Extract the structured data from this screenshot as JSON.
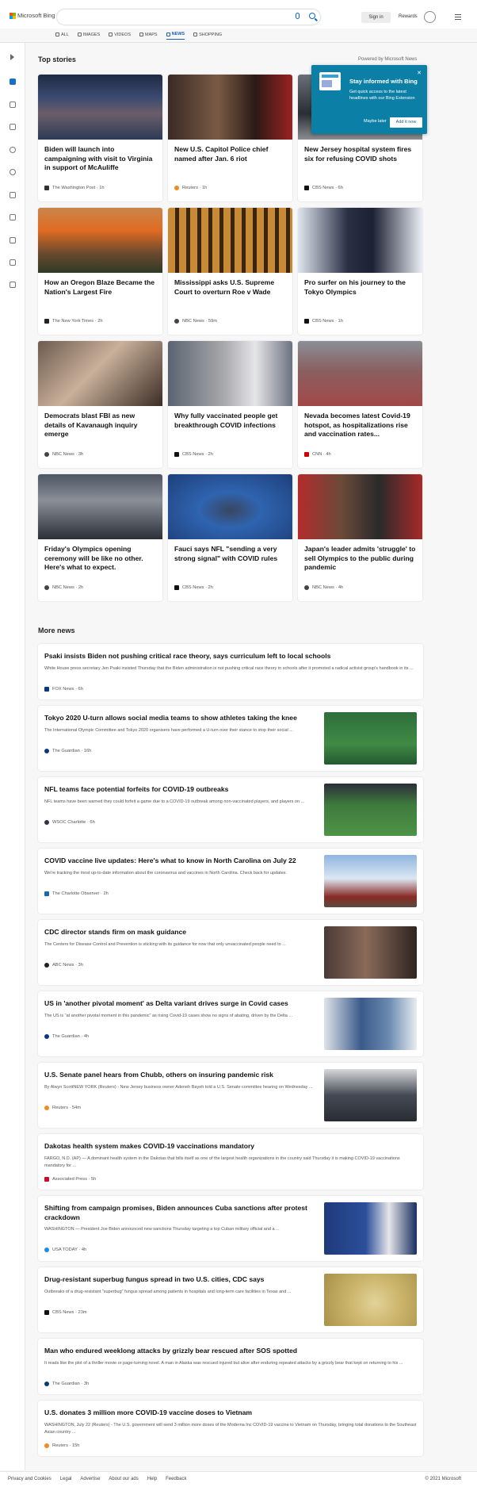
{
  "header": {
    "logo_text": "Microsoft Bing",
    "sign_in": "Sign in",
    "rewards": "Rewards"
  },
  "nav": [
    {
      "label": "ALL",
      "icon": "search-icon"
    },
    {
      "label": "IMAGES",
      "icon": "image-icon"
    },
    {
      "label": "VIDEOS",
      "icon": "video-icon"
    },
    {
      "label": "MAPS",
      "icon": "map-pin-icon"
    },
    {
      "label": "NEWS",
      "icon": "news-icon",
      "active": true
    },
    {
      "label": "SHOPPING",
      "icon": "shopping-bag-icon"
    }
  ],
  "top_stories": {
    "title": "Top stories",
    "powered_by": "Powered by Microsoft News",
    "cards": [
      {
        "title": "Biden will launch into campaigning with visit to Virginia in support of McAuliffe",
        "source": "The Washington Post · 1h"
      },
      {
        "title": "New U.S. Capitol Police chief named after Jan. 6 riot",
        "source": "Reuters · 1h"
      },
      {
        "title": "New Jersey hospital system fires six for refusing COVID shots",
        "source": "CBS News · 6h"
      },
      {
        "title": "How an Oregon Blaze Became the Nation's Largest Fire",
        "source": "The New York Times · 2h"
      },
      {
        "title": "Mississippi asks U.S. Supreme Court to overturn Roe v Wade",
        "source": "NBC News · 59m"
      },
      {
        "title": "Pro surfer on his journey to the Tokyo Olympics",
        "source": "CBS News · 1h"
      },
      {
        "title": "Democrats blast FBI as new details of Kavanaugh inquiry emerge",
        "source": "NBC News · 3h"
      },
      {
        "title": "Why fully vaccinated people get breakthrough COVID infections",
        "source": "CBS News · 2h"
      },
      {
        "title": "Nevada becomes latest Covid-19 hotspot, as hospitalizations rise and vaccination rates...",
        "source": "CNN · 4h"
      },
      {
        "title": "Friday's Olympics opening ceremony will be like no other. Here's what to expect.",
        "source": "NBC News · 2h"
      },
      {
        "title": "Fauci says NFL \"sending a very strong signal\" with COVID rules",
        "source": "CBS News · 2h"
      },
      {
        "title": "Japan's leader admits 'struggle' to sell Olympics to the public during pandemic",
        "source": "NBC News · 4h"
      }
    ]
  },
  "popup": {
    "title": "Stay informed with Bing",
    "body": "Get quick access to the latest headlines with our Bing Extension",
    "maybe_later": "Maybe later",
    "add_it_now": "Add it now"
  },
  "more_news": {
    "title": "More news",
    "items": [
      {
        "title": "Psaki insists Biden not pushing critical race theory, says curriculum left to local schools",
        "desc": "White House press secretary Jen Psaki insisted Thursday that the Biden administration is not pushing critical race theory in schools after it promoted a radical activist group's handbook in its ...",
        "source": "FOX News · 6h"
      },
      {
        "title": "Tokyo 2020 U-turn allows social media teams to show athletes taking the knee",
        "desc": "The International Olympic Committee and Tokyo 2020 organisers have performed a U-turn over their stance to stop their social ...",
        "source": "The Guardian · 16h"
      },
      {
        "title": "NFL teams face potential forfeits for COVID-19 outbreaks",
        "desc": "NFL teams have been warned they could forfeit a game due to a COVID-19 outbreak among non-vaccinated players, and players on ...",
        "source": "WSOC Charlotte · 6h"
      },
      {
        "title": "COVID vaccine live updates: Here's what to know in North Carolina on July 22",
        "desc": "We're tracking the most up-to-date information about the coronavirus and vaccines in North Carolina. Check back for updates.",
        "source": "The Charlotte Observer · 2h"
      },
      {
        "title": "CDC director stands firm on mask guidance",
        "desc": "The Centers for Disease Control and Prevention is sticking with its guidance for now that only unvaccinated people need to ...",
        "source": "ABC News · 3h"
      },
      {
        "title": "US in 'another pivotal moment' as Delta variant drives surge in Covid cases",
        "desc": "The US is \"at another pivotal moment in this pandemic\" as rising Covid-19 cases show no signs of abating, driven by the Delta ...",
        "source": "The Guardian · 4h"
      },
      {
        "title": "U.S. Senate panel hears from Chubb, others on insuring pandemic risk",
        "desc": "By Alwyn ScottNEW YORK (Reuters) - New Jersey business owner Adeneh Bayeh told a U.S. Senate committee hearing on Wednesday ...",
        "source": "Reuters · 54m"
      },
      {
        "title": "Dakotas health system makes COVID-19 vaccinations mandatory",
        "desc": "FARGO, N.D. (AP) — A dominant health system in the Dakotas that bills itself as one of the largest health organizations in the country said Thursday it is making COVID-19 vaccinations mandatory for ...",
        "source": "Associated Press · 5h"
      },
      {
        "title": "Shifting from campaign promises, Biden announces Cuba sanctions after protest crackdown",
        "desc": "WASHINGTON — President Joe Biden announced new sanctions Thursday targeting a top Cuban military official and a ...",
        "source": "USA TODAY · 4h"
      },
      {
        "title": "Drug-resistant superbug fungus spread in two U.S. cities, CDC says",
        "desc": "Outbreaks of a drug-resistant \"superbug\" fungus spread among patients in hospitals and long-term care facilities in Texas and ...",
        "source": "CBS News · 23m"
      },
      {
        "title": "Man who endured weeklong attacks by grizzly bear rescued after SOS spotted",
        "desc": "It reads like the plot of a thriller movie or page-turning novel. A man in Alaska was rescued injured but alive after enduring repeated attacks by a grizzly bear that kept on returning to his ...",
        "source": "The Guardian · 3h"
      },
      {
        "title": "U.S. donates 3 million more COVID-19 vaccine doses to Vietnam",
        "desc": "WASHINGTON, July 22 (Reuters) - The U.S. government will send 3 million more doses of the Moderna Inc COVID-19 vaccine to Vietnam on Thursday, bringing total donations to the Southeast Asian country ...",
        "source": "Reuters · 15h"
      }
    ]
  },
  "footer": {
    "links": [
      "Privacy and Cookies",
      "Legal",
      "Advertise",
      "About our ads",
      "Help",
      "Feedback"
    ],
    "copyright": "© 2021 Microsoft"
  }
}
